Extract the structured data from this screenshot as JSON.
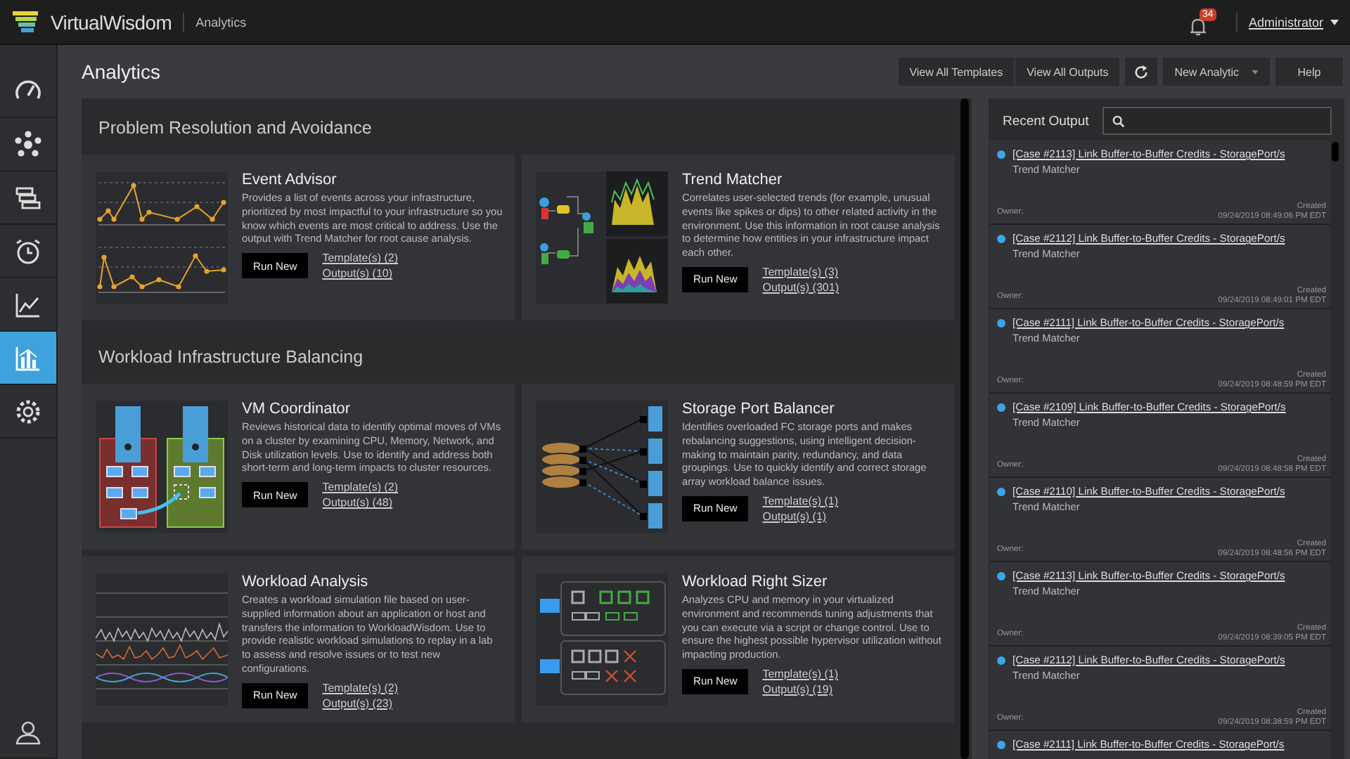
{
  "topbar": {
    "brand": "VirtualWisdom",
    "section": "Analytics",
    "notifications": "34",
    "user": "Administrator"
  },
  "sidebar": {
    "items": [
      {
        "selected": false
      },
      {
        "selected": false
      },
      {
        "selected": false
      },
      {
        "selected": false
      },
      {
        "selected": false
      },
      {
        "selected": true
      },
      {
        "selected": false
      }
    ]
  },
  "page": {
    "title": "Analytics"
  },
  "toolbar": {
    "buttons": [
      "View All Templates",
      "View All Outputs"
    ],
    "new_analytic": "New Analytic",
    "help": "Help"
  },
  "sections": [
    {
      "title": "Problem Resolution and Avoidance",
      "cards": [
        {
          "kind": "events",
          "title": "Event Advisor",
          "description": "Provides a list of events across your infrastructure, prioritized by most impactful to your infrastructure so you know which events are most critical to address. Use the output with Trend Matcher for root cause analysis.",
          "button": "Run New",
          "templates": "Template(s)  (2)",
          "outputs": "Output(s) (10)"
        },
        {
          "kind": "trends",
          "title": "Trend Matcher",
          "description": "Correlates user-selected trends (for example, unusual events like spikes or dips) to other related activity in the environment. Use this information in root cause analysis to determine how entities in your infrastructure impact each other.",
          "button": "Run New",
          "templates": "Template(s)  (3)",
          "outputs": "Output(s) (301)"
        }
      ]
    },
    {
      "title": "Workload Infrastructure Balancing",
      "cards": [
        {
          "kind": "vms",
          "title": "VM Coordinator",
          "description": "Reviews historical data to identify optimal moves of VMs on a cluster by examining CPU, Memory, Network, and Disk utilization levels. Use to identify and address both short-term and long-term impacts to cluster resources.",
          "button": "Run New",
          "templates": "Template(s)  (2)",
          "outputs": "Output(s) (48)"
        },
        {
          "kind": "storage",
          "title": "Storage Port Balancer",
          "description": "Identifies overloaded FC storage ports and makes rebalancing suggestions, using intelligent decision-making to maintain parity, redundancy, and data groupings. Use to quickly identify and correct storage array workload balance issues.",
          "button": "Run New",
          "templates": "Template(s)  (1)",
          "outputs": "Output(s) (1)"
        },
        {
          "kind": "workload",
          "title": "Workload Analysis",
          "description": "Creates a workload simulation file based on user-supplied information about an application or host and transfers the information to WorkloadWisdom. Use to provide realistic workload simulations to replay in a lab to assess and resolve issues or to test new configurations.",
          "button": "Run New",
          "templates": "Template(s)  (2)",
          "outputs": "Output(s) (23)"
        },
        {
          "kind": "sizer",
          "title": "Workload Right Sizer",
          "description": "Analyzes CPU and memory in your virtualized environment and recommends tuning adjustments that you can execute via a script or change control. Use to ensure the highest possible hypervisor utilization without impacting production.",
          "button": "Run New",
          "templates": "Template(s)  (1)",
          "outputs": "Output(s) (19)"
        }
      ]
    }
  ],
  "recent_output": {
    "title": "Recent Output",
    "items": [
      {
        "title": "[Case #2113] Link Buffer-to-Buffer Credits - StoragePort/s",
        "type": "Trend Matcher",
        "owner": "Owner:",
        "created": "Created",
        "date": "09/24/2019 08:49:06 PM EDT"
      },
      {
        "title": "[Case #2112] Link Buffer-to-Buffer Credits - StoragePort/s",
        "type": "Trend Matcher",
        "owner": "Owner:",
        "created": "Created",
        "date": "09/24/2019 08:49:01 PM EDT"
      },
      {
        "title": "[Case #2111] Link Buffer-to-Buffer Credits - StoragePort/s",
        "type": "Trend Matcher",
        "owner": "Owner:",
        "created": "Created",
        "date": "09/24/2019 08:48:59 PM EDT"
      },
      {
        "title": "[Case #2109] Link Buffer-to-Buffer Credits - StoragePort/s",
        "type": "Trend Matcher",
        "owner": "Owner:",
        "created": "Created",
        "date": "09/24/2019 08:48:58 PM EDT"
      },
      {
        "title": "[Case #2110] Link Buffer-to-Buffer Credits - StoragePort/s",
        "type": "Trend Matcher",
        "owner": "Owner:",
        "created": "Created",
        "date": "09/24/2019 08:48:56 PM EDT"
      },
      {
        "title": "[Case #2113] Link Buffer-to-Buffer Credits - StoragePort/s",
        "type": "Trend Matcher",
        "owner": "Owner:",
        "created": "Created",
        "date": "09/24/2019 08:39:05 PM EDT"
      },
      {
        "title": "[Case #2112] Link Buffer-to-Buffer Credits - StoragePort/s",
        "type": "Trend Matcher",
        "owner": "Owner:",
        "created": "Created",
        "date": "09/24/2019 08:38:59 PM EDT"
      },
      {
        "title": "[Case #2111] Link Buffer-to-Buffer Credits - StoragePort/s"
      }
    ]
  }
}
